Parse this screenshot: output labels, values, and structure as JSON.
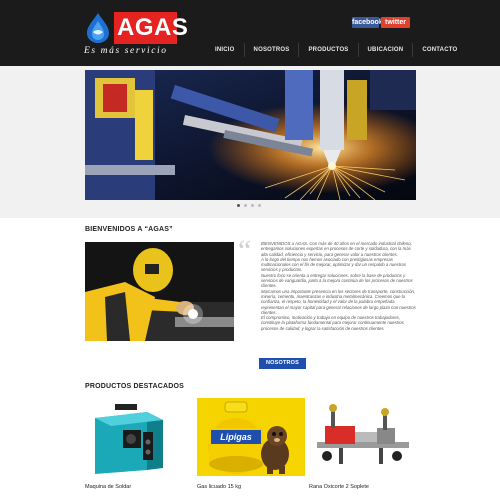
{
  "brand": {
    "name": "AGAS",
    "tagline": "Es más servicio",
    "logo_icon": "flame-drop-icon",
    "colors": {
      "red": "#e52321",
      "blue": "#1f4fae"
    }
  },
  "social": {
    "facebook": "facebook",
    "twitter": "twitter"
  },
  "nav": {
    "items": [
      "INICIO",
      "NOSOTROS",
      "PRODUCTOS",
      "UBICACION",
      "CONTACTO"
    ]
  },
  "slider": {
    "image": "welding-torch-sparks",
    "dots": 4,
    "active_dot": 1
  },
  "welcome": {
    "title": "BIENVENIDOS A “AGAS”",
    "photo": "welder-with-yellow-helmet",
    "paragraphs": [
      "BIENVENIDOS a AGAS. Con más de 40 años en el mercado industrial chileno, entregamos soluciones expertas en procesos de corte y soldadura, con la más alta calidad, eficiencia y servicio, para generar valor a nuestros clientes.",
      "A lo largo del tiempo nos hemos asociado con prestigiosas empresas multinacionales con el fin de mejorar, optimizar y dar un respaldo a nuestros servicios y productos.",
      "Nuestro foco se orienta a entregar soluciones, sobre la base de productos y servicios de vanguardia, junto a la mejora continua de los procesos de nuestros clientes.",
      "Marcamos una importante presencia en los sectores de transporte, construcción, minería, cemento, maestranzas e industria metalmecánica. Creemos que la confianza, el respeto, la honestidad y el valor de la palabra empeñada representan el mayor capital para generar relaciones de largo plazo con nuestros clientes.",
      "El compromiso, motivación y trabajo en equipo de nuestros trabajadores, constituye la plataforma fundamental para mejorar continuamente nuestros procesos de calidad, y lograr la satisfacción de nuestros clientes."
    ],
    "button": "NOSOTROS"
  },
  "products": {
    "title": "PRODUCTOS DESTACADOS",
    "items": [
      {
        "name": "Maquina de Soldar",
        "image": "welding-machine"
      },
      {
        "name": "Gas licuado 15 kg",
        "image": "gas-cylinder-lipigas",
        "brand_label": "Lipigas"
      },
      {
        "name": "Rana Oxicorte 2 Soplete",
        "image": "oxyfuel-cutting-machine"
      }
    ]
  }
}
